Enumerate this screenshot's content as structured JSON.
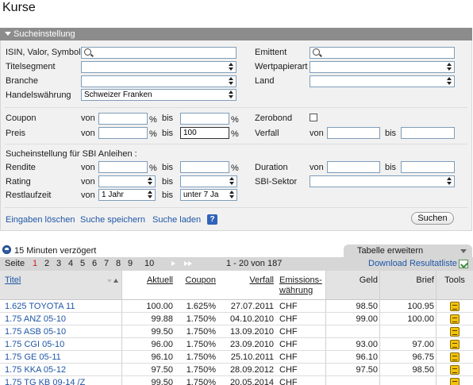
{
  "page_title": "Kurse",
  "panel": {
    "header": "Sucheinstellung",
    "labels": {
      "isin": "ISIN, Valor, Symbol",
      "titelsegment": "Titelsegment",
      "branche": "Branche",
      "handelswaehrung": "Handelswährung",
      "emittent": "Emittent",
      "wertpapierart": "Wertpapierart",
      "land": "Land",
      "coupon": "Coupon",
      "preis": "Preis",
      "zerobond": "Zerobond",
      "verfall": "Verfall",
      "sbi_heading": "Sucheinstellung für SBI Anleihen :",
      "rendite": "Rendite",
      "rating": "Rating",
      "restlaufzeit": "Restlaufzeit",
      "duration": "Duration",
      "sbi_sektor": "SBI-Sektor",
      "von": "von",
      "bis": "bis",
      "pct": "%"
    },
    "values": {
      "handelswaehrung": "Schweizer Franken",
      "preis_bis": "100",
      "restlaufzeit_von": "1 Jahr",
      "restlaufzeit_bis": "unter 7 Ja"
    },
    "actions": {
      "clear": "Eingaben löschen",
      "save": "Suche speichern",
      "load": "Suche laden",
      "help": "?",
      "search_button": "Suchen"
    }
  },
  "delay_notice": "15 Minuten verzögert",
  "tabelle_tab": "Tabelle erweitern",
  "pager": {
    "label": "Seite",
    "pages": [
      "1",
      "2",
      "3",
      "4",
      "5",
      "6",
      "7",
      "8",
      "9",
      "10"
    ],
    "active_page": "1",
    "range": "1 - 20 von 187",
    "download": "Download Resultatliste"
  },
  "table": {
    "columns": {
      "titel": "Titel",
      "aktuell": "Aktuell",
      "coupon": "Coupon",
      "verfall": "Verfall",
      "emission_1": "Emissions-",
      "emission_2": "währung",
      "geld": "Geld",
      "brief": "Brief",
      "tools": "Tools"
    },
    "rows": [
      {
        "titel": "1.625 TOYOTA 11",
        "aktuell": "100.00",
        "coupon": "1.625%",
        "verfall": "27.07.2011",
        "waehrung": "CHF",
        "geld": "98.50",
        "brief": "100.95"
      },
      {
        "titel": "1.75 ANZ 05-10",
        "aktuell": "99.88",
        "coupon": "1.750%",
        "verfall": "04.10.2010",
        "waehrung": "CHF",
        "geld": "99.00",
        "brief": "100.00"
      },
      {
        "titel": "1.75 ASB 05-10",
        "aktuell": "99.50",
        "coupon": "1.750%",
        "verfall": "13.09.2010",
        "waehrung": "CHF",
        "geld": "",
        "brief": ""
      },
      {
        "titel": "1.75 CGI 05-10",
        "aktuell": "96.00",
        "coupon": "1.750%",
        "verfall": "23.09.2010",
        "waehrung": "CHF",
        "geld": "93.00",
        "brief": "97.00"
      },
      {
        "titel": "1.75 GE 05-11",
        "aktuell": "96.10",
        "coupon": "1.750%",
        "verfall": "25.10.2011",
        "waehrung": "CHF",
        "geld": "96.10",
        "brief": "96.75"
      },
      {
        "titel": "1.75 KKA 05-12",
        "aktuell": "97.50",
        "coupon": "1.750%",
        "verfall": "28.09.2012",
        "waehrung": "CHF",
        "geld": "97.50",
        "brief": "98.50"
      },
      {
        "titel": "1.75 TG KB 09-14 /Z",
        "aktuell": "99.50",
        "coupon": "1.750%",
        "verfall": "20.05.2014",
        "waehrung": "CHF",
        "geld": "",
        "brief": ""
      }
    ]
  }
}
